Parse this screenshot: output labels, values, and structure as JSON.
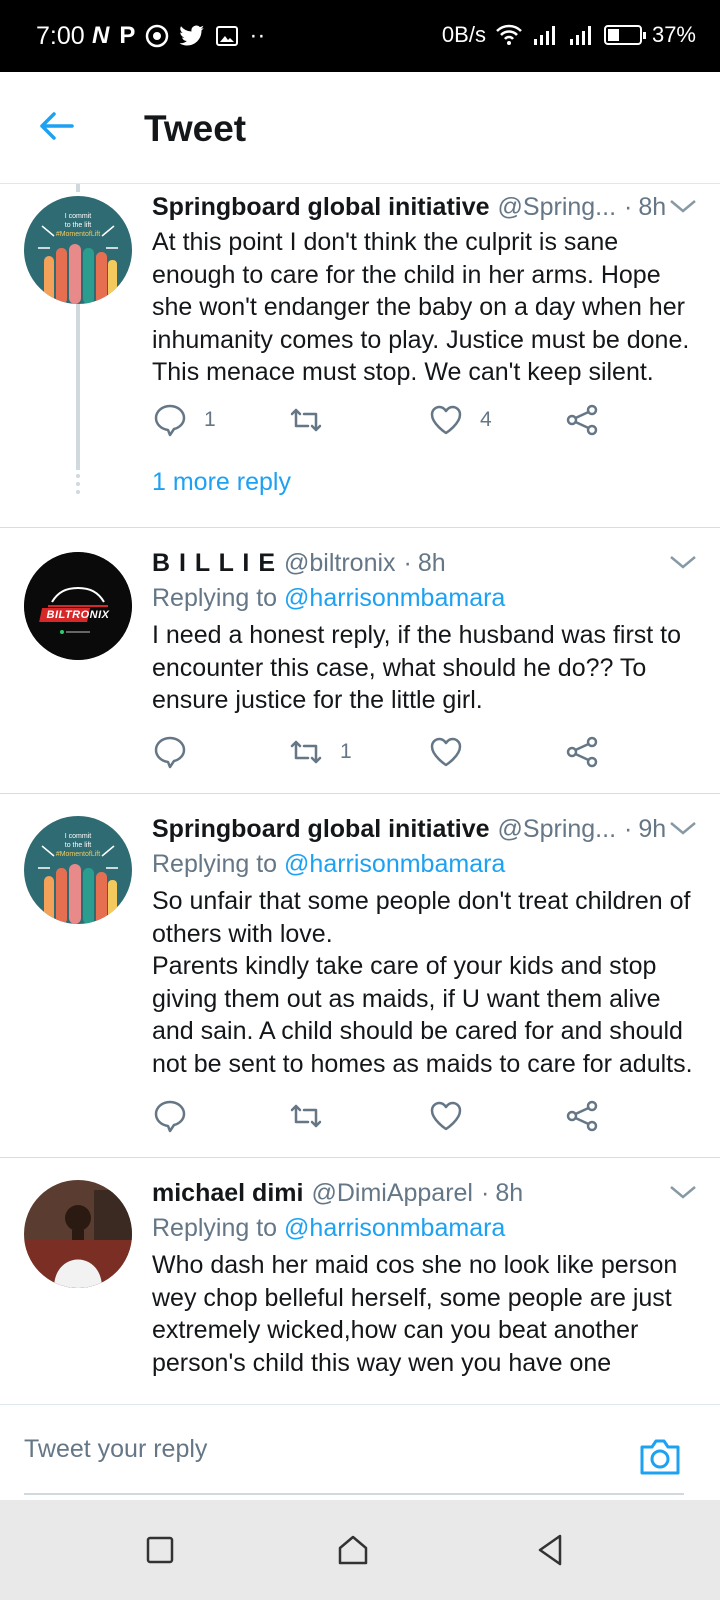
{
  "status_bar": {
    "time": "7:00",
    "notification_icons": [
      "N",
      "P"
    ],
    "more_indicator": "··",
    "network_speed": "0B/s",
    "battery_level": 0.37,
    "battery_text": "37%"
  },
  "header": {
    "title": "Tweet"
  },
  "tweets": [
    {
      "name": "Springboard global initiative",
      "handle": "@Spring...",
      "dot": "·",
      "time": "8h",
      "avatar": {
        "type": "hands-illustration",
        "text": [
          "I commit",
          "to the lift",
          "#MomentofLift"
        ],
        "bg": "#2e6b73"
      },
      "text_lines": [
        "At this point I don't think the culprit is sane",
        "enough to care for the child in her arms. Hope",
        "she won't endanger the baby on a day when her",
        "inhumanity comes to play. Justice must be done.",
        "This menace must stop. We can't keep silent."
      ],
      "reply_count": "1",
      "retweet_count": "",
      "like_count": "4",
      "more_replies": "1 more reply"
    },
    {
      "name": "B I L L I E",
      "handle": "@biltronix",
      "dot": "·",
      "time": "8h",
      "avatar": {
        "type": "logo",
        "text": "BILTRONIX",
        "bg": "#0a0a0a"
      },
      "reply_prefix": "Replying to",
      "reply_mention": "@harrisonmbamara",
      "text_lines": [
        "I need a honest reply, if the husband was first to",
        "encounter this case, what should he do?? To",
        "ensure justice for the little girl."
      ],
      "reply_count": "",
      "retweet_count": "1",
      "like_count": ""
    },
    {
      "name": "Springboard global initiative",
      "handle": "@Spring...",
      "dot": "·",
      "time": "9h",
      "avatar": {
        "type": "hands-illustration",
        "text": [
          "I commit",
          "to the lift",
          "#MomentofLift"
        ],
        "bg": "#2e6b73"
      },
      "reply_prefix": "Replying to",
      "reply_mention": "@harrisonmbamara",
      "text_lines": [
        "So unfair that some people don't treat children of",
        "others with love.",
        "Parents kindly take care of your kids and stop",
        "giving them out as maids, if U want them alive",
        "and sain. A child should be cared for and should",
        "not be sent to homes as maids to care for adults."
      ],
      "reply_count": "",
      "retweet_count": "",
      "like_count": ""
    },
    {
      "name": "michael dimi",
      "handle": "@DimiApparel",
      "dot": "·",
      "time": "8h",
      "avatar": {
        "type": "photo",
        "bg": "#6b4a3a"
      },
      "reply_prefix": "Replying to",
      "reply_mention": "@harrisonmbamara",
      "text_lines": [
        "Who dash her maid cos she no look like person",
        "wey chop belleful herself, some people are just",
        "extremely wicked,how can you beat another",
        "person's child this way wen you have one"
      ]
    }
  ],
  "reply_bar": {
    "placeholder": "Tweet your reply"
  },
  "colors": {
    "accent": "#1da1f2",
    "secondary_text": "#657786",
    "divider": "#d6dde3"
  },
  "icons": {
    "back": "arrow-left-icon",
    "chevron": "chevron-down-icon",
    "reply": "speech-bubble-icon",
    "retweet": "retweet-icon",
    "like": "heart-icon",
    "share": "share-icon",
    "camera": "camera-icon"
  }
}
